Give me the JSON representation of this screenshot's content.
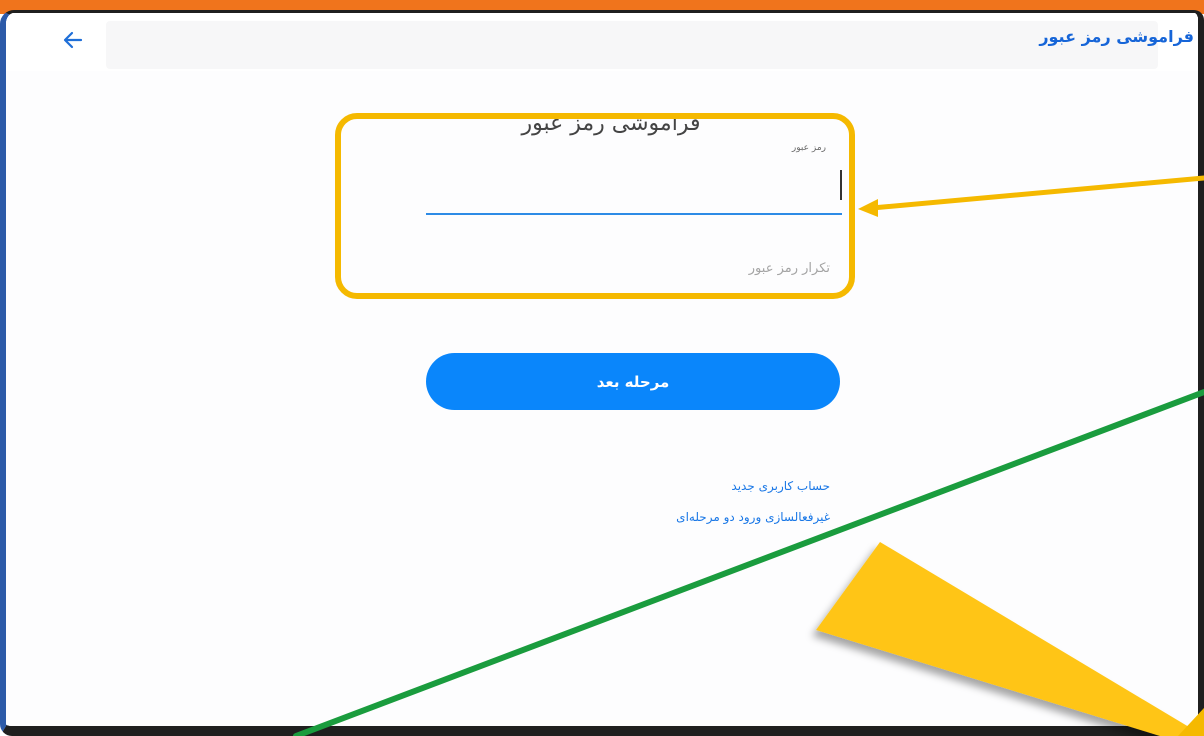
{
  "appbar": {
    "title": "فراموشی رمز عبور",
    "back_icon": "arrow-left-icon"
  },
  "form": {
    "heading": "فراموشی رمز عبور",
    "password_label": "رمز عبور",
    "password_value": "",
    "confirm_placeholder": "تکرار رمز عبور"
  },
  "next_button": {
    "label": "مرحله بعد"
  },
  "links": {
    "new_account": "حساب کاربری جدید",
    "disable_2fa": "غیرفعالسازی ورود دو مرحله‌ای"
  },
  "colors": {
    "accent": "#0a86fb",
    "link": "#1977e6",
    "annotation_yellow": "#f5b900",
    "annotation_green": "#1a9c3e",
    "top_strip": "#f0741c"
  }
}
